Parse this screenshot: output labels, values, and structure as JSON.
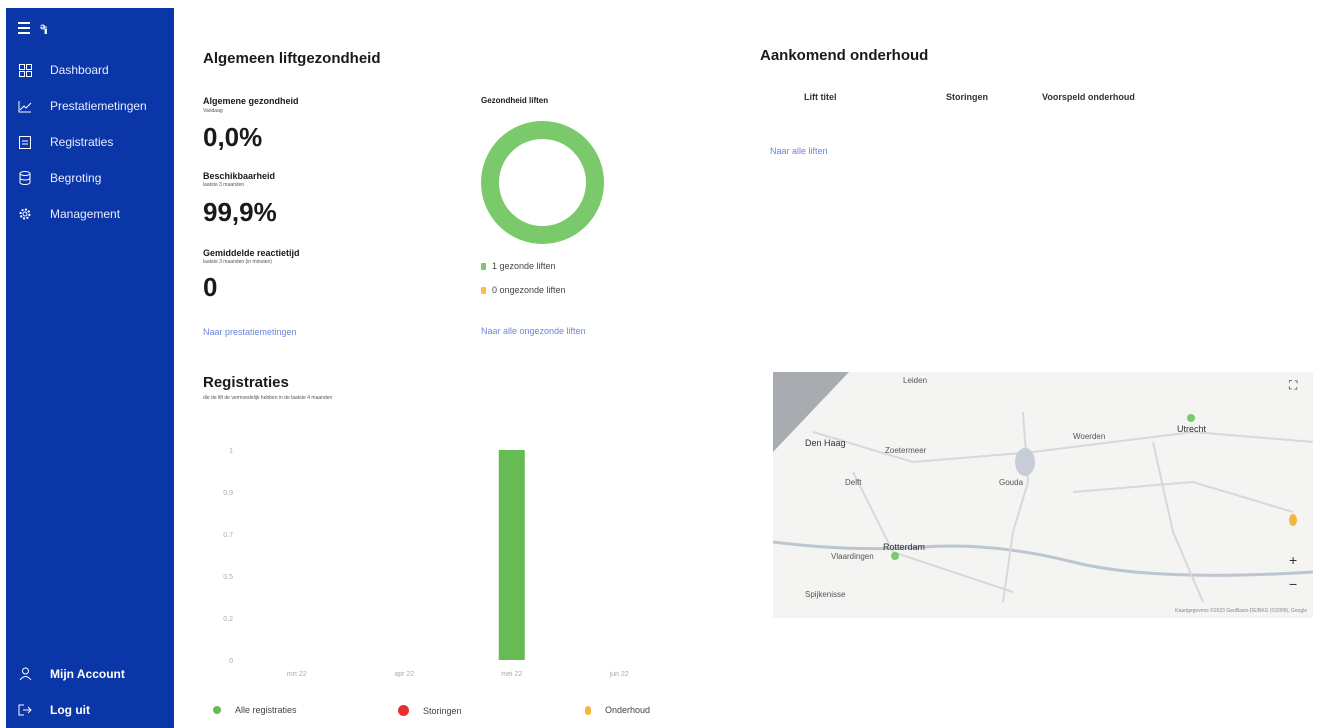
{
  "sidebar": {
    "logo": "ᵊᵢᵢ",
    "items": [
      {
        "label": "Dashboard",
        "icon": "grid-icon"
      },
      {
        "label": "Prestatiemetingen",
        "icon": "chart-line-icon"
      },
      {
        "label": "Registraties",
        "icon": "clipboard-icon"
      },
      {
        "label": "Begroting",
        "icon": "database-icon"
      },
      {
        "label": "Management",
        "icon": "gear-icon"
      }
    ],
    "bottom": [
      {
        "label": "Mijn Account",
        "icon": "person-icon"
      },
      {
        "label": "Log uit",
        "icon": "logout-icon"
      }
    ],
    "bg_color": "#0b36a8"
  },
  "health": {
    "title": "Algemeen liftgezondheid",
    "metrics": [
      {
        "label": "Algemene gezondheid",
        "sub": "Vandaag",
        "value": "0,0%"
      },
      {
        "label": "Beschikbaarheid",
        "sub": "laatste 3 maanden",
        "value": "99,9%"
      },
      {
        "label": "Gemiddelde reactietijd",
        "sub": "laatste 3 maanden (in minuten)",
        "value": "0"
      }
    ],
    "link": "Naar prestatiemetingen",
    "donut_title": "Gezondheid liften",
    "donut_legend": [
      {
        "label": "1 gezonde liften",
        "color": "#7ac96b"
      },
      {
        "label": "0 ongezonde liften",
        "color": "#f3c04a"
      }
    ],
    "donut_link": "Naar alle ongezonde liften"
  },
  "maintenance": {
    "title": "Aankomend onderhoud",
    "columns": [
      "Lift titel",
      "Storingen",
      "Voorspeld onderhoud"
    ],
    "link": "Naar alle liften"
  },
  "map": {
    "labels": [
      "Leiden",
      "Den Haag",
      "Zoetermeer",
      "Woerden",
      "Utrecht",
      "Gouda",
      "Delft",
      "Rotterdam",
      "Vlaardingen",
      "Spijkenisse"
    ],
    "attribution": "Kaartgegevens ©2023 GeoBasis-DE/BKG (©2009), Google",
    "zoom_in": "+",
    "zoom_out": "−",
    "fullscreen": "⛶"
  },
  "registraties": {
    "title": "Registraties",
    "subtitle": "die de lift de vermoedelijk hebben in de laatste 4 maanden"
  },
  "chart_data": {
    "type": "bar",
    "categories": [
      "mrt 22",
      "apr 22",
      "mei 22",
      "jun 22"
    ],
    "series": [
      {
        "name": "Alle registraties",
        "values": [
          0,
          0,
          1,
          0
        ],
        "color": "#66bb55"
      }
    ],
    "ylim": [
      0,
      1
    ],
    "yticks": [
      "0",
      "0.2",
      "0.5",
      "0.7",
      "0.9",
      "1"
    ],
    "legend": [
      {
        "label": "Alle registraties",
        "color": "#66bb55"
      },
      {
        "label": "Storingen",
        "color": "#e53030"
      },
      {
        "label": "Onderhoud",
        "color": "#f3b740"
      }
    ]
  }
}
